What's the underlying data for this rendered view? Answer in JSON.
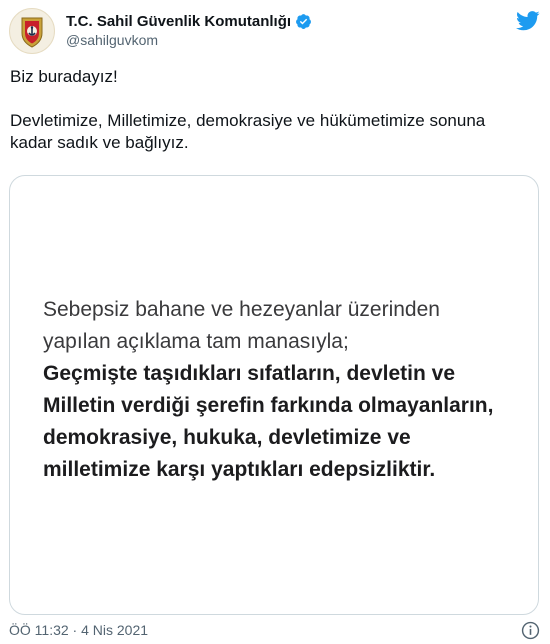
{
  "author": {
    "display_name": "T.C. Sahil Güvenlik Komutanlığı",
    "handle": "@sahilguvkom",
    "verified": true,
    "avatar_icon": "coast-guard-emblem-icon"
  },
  "platform_icon": "twitter-bird-icon",
  "tweet": {
    "line1": "Biz buradayız!",
    "line2": "Devletimize, Milletimize, demokrasiye ve hükümetimize sonuna kadar sadık ve bağlıyız."
  },
  "media": {
    "regular_lines": [
      "Sebepsiz bahane ve hezeyanlar üzerinden",
      "yapılan açıklama tam manasıyla;"
    ],
    "bold_lines": [
      "Geçmişte taşıdıkları sıfatların, devletin ve",
      "Milletin verdiği şerefin farkında olmayanların,",
      "demokrasiye, hukuka, devletimize ve",
      "milletimize karşı yaptıkları edepsizliktir."
    ]
  },
  "footer": {
    "timestamp": "ÖÖ 11:32 · 4 Nis 2021",
    "info_icon": "info-icon"
  },
  "colors": {
    "twitter_blue": "#1d9bf0",
    "text_primary": "#0f1419",
    "text_secondary": "#536471",
    "border": "#cfd9de"
  }
}
